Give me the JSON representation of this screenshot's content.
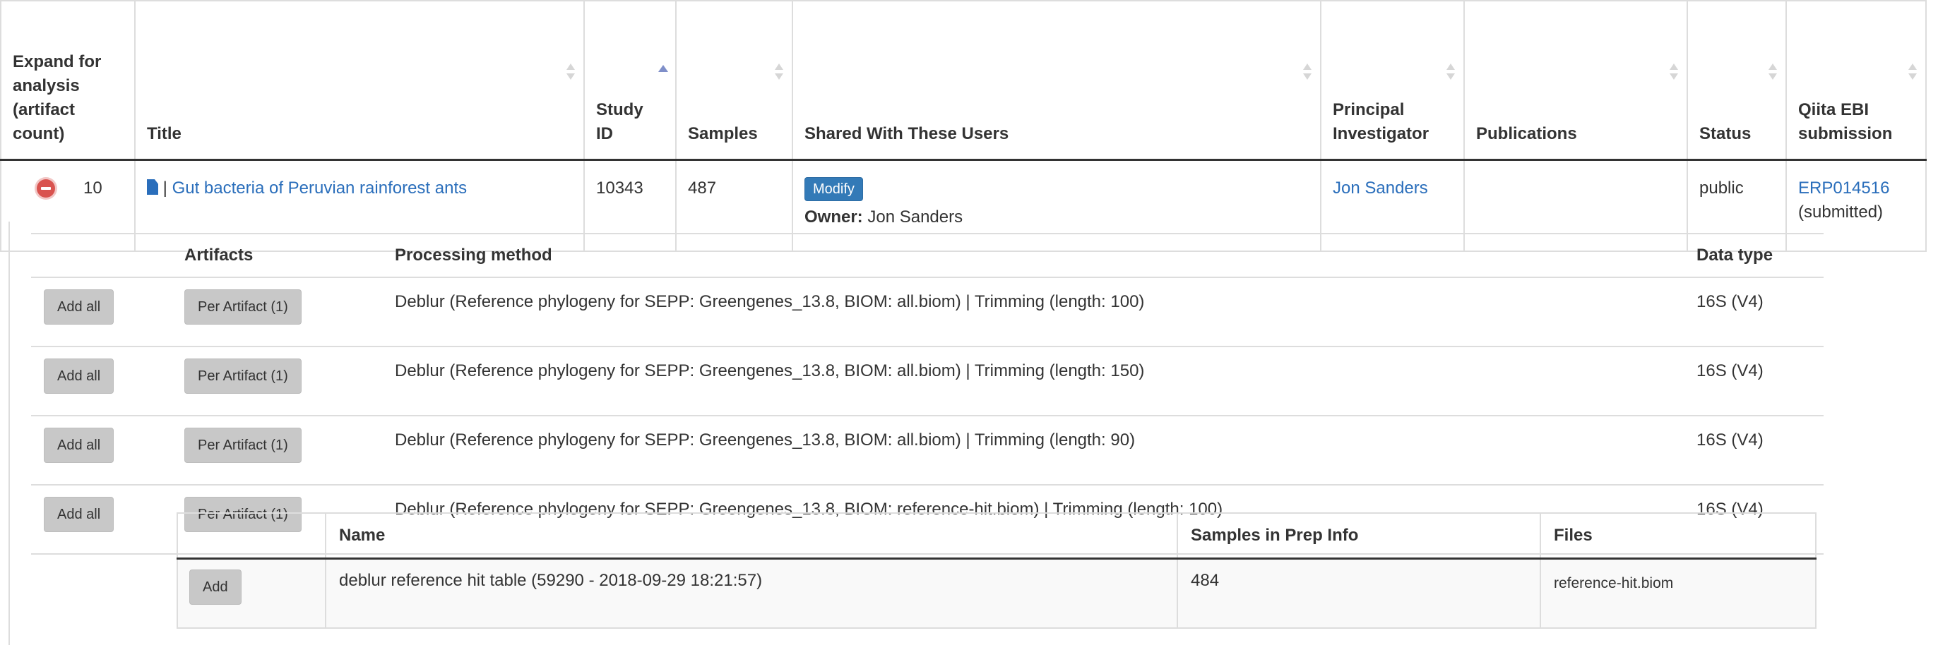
{
  "study_table": {
    "columns": [
      {
        "label": "Expand for analysis (artifact count)",
        "sort": "none"
      },
      {
        "label": "Title",
        "sort": "both"
      },
      {
        "label": "Study ID",
        "sort": "asc"
      },
      {
        "label": "Samples",
        "sort": "both"
      },
      {
        "label": "Shared With These Users",
        "sort": "both"
      },
      {
        "label": "Principal Investigator",
        "sort": "both"
      },
      {
        "label": "Publications",
        "sort": "both"
      },
      {
        "label": "Status",
        "sort": "both"
      },
      {
        "label": "Qiita EBI submission",
        "sort": "both"
      }
    ],
    "row": {
      "artifact_count": "10",
      "title_separator": "|",
      "title": "Gut bacteria of Peruvian rainforest ants",
      "study_id": "10343",
      "samples": "487",
      "modify_label": "Modify",
      "owner_label": "Owner:",
      "owner_name": "Jon Sanders",
      "pi": "Jon Sanders",
      "publications": "",
      "status": "public",
      "ebi_accession": "ERP014516",
      "ebi_state": "(submitted)"
    }
  },
  "artifacts_table": {
    "headers": {
      "artifacts": "Artifacts",
      "processing": "Processing method",
      "data_type": "Data type"
    },
    "rows": [
      {
        "add_all": "Add all",
        "per_artifact": "Per Artifact (1)",
        "processing": "Deblur (Reference phylogeny for SEPP: Greengenes_13.8, BIOM: all.biom) | Trimming (length: 100)",
        "data_type": "16S (V4)"
      },
      {
        "add_all": "Add all",
        "per_artifact": "Per Artifact (1)",
        "processing": "Deblur (Reference phylogeny for SEPP: Greengenes_13.8, BIOM: all.biom) | Trimming (length: 150)",
        "data_type": "16S (V4)"
      },
      {
        "add_all": "Add all",
        "per_artifact": "Per Artifact (1)",
        "processing": "Deblur (Reference phylogeny for SEPP: Greengenes_13.8, BIOM: all.biom) | Trimming (length: 90)",
        "data_type": "16S (V4)"
      },
      {
        "add_all": "Add all",
        "per_artifact": "Per Artifact (1)",
        "processing": "Deblur (Reference phylogeny for SEPP: Greengenes_13.8, BIOM: reference-hit.biom) | Trimming (length: 100)",
        "data_type": "16S (V4)"
      }
    ]
  },
  "detail_table": {
    "headers": {
      "name": "Name",
      "samples": "Samples in Prep Info",
      "files": "Files"
    },
    "row": {
      "add": "Add",
      "name": "deblur reference hit table (59290 - 2018-09-29 18:21:57)",
      "samples": "484",
      "files": "reference-hit.biom"
    }
  }
}
